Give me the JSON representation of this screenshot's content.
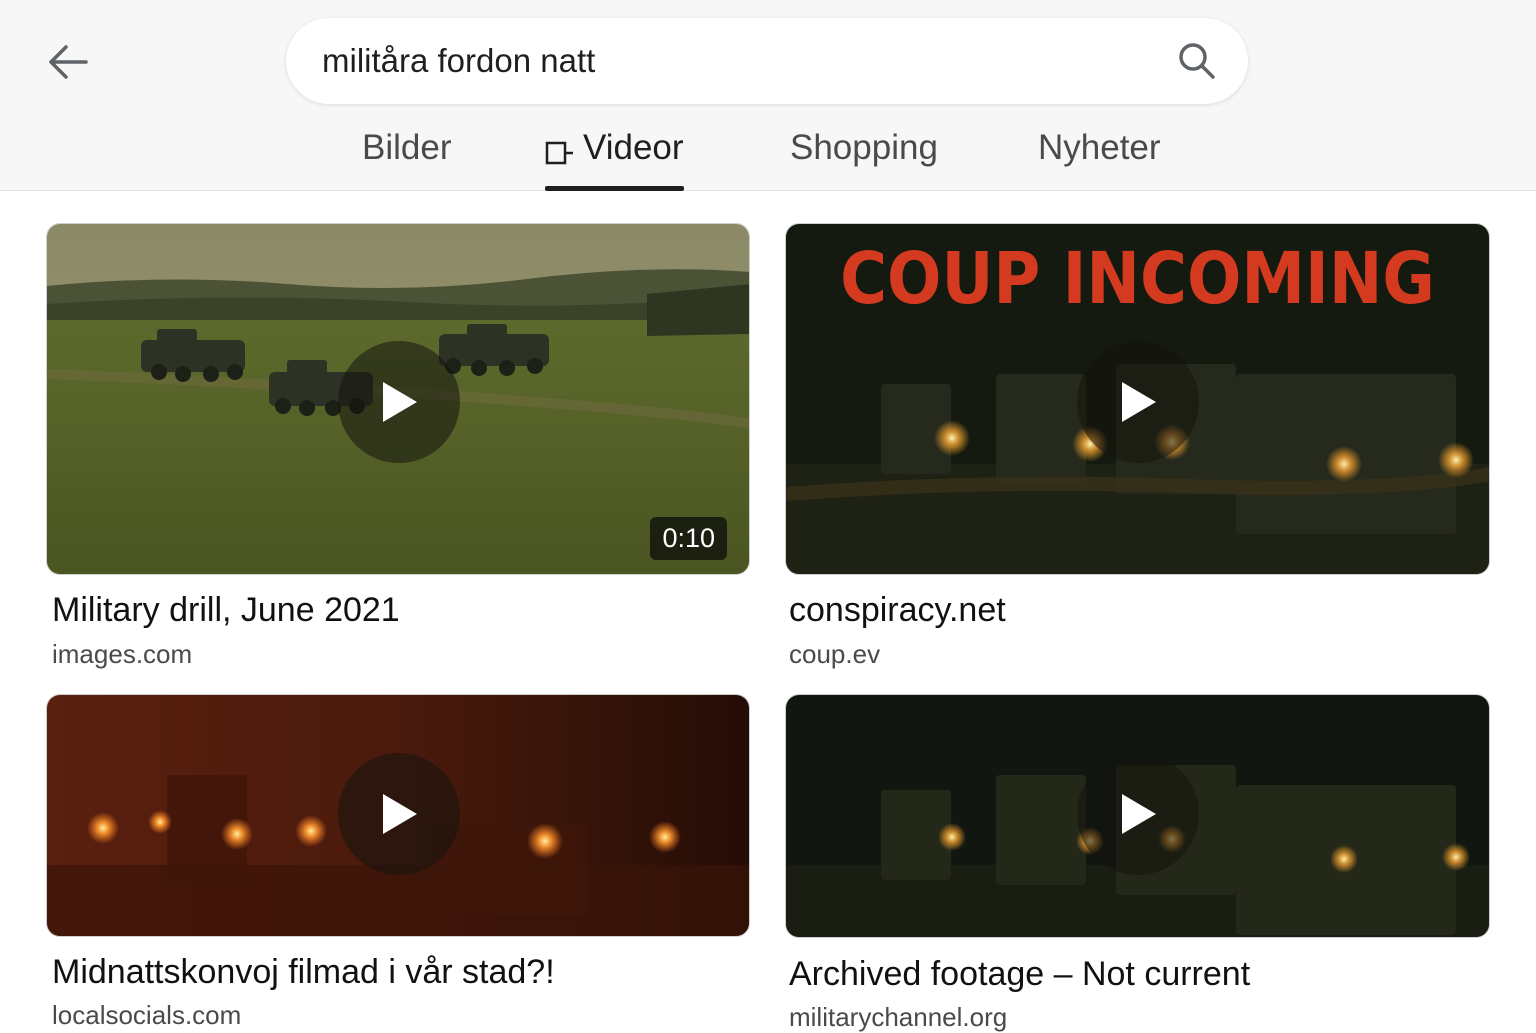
{
  "search": {
    "query": "militåra fordon natt"
  },
  "tabs": [
    {
      "label": "Bilder",
      "active": false
    },
    {
      "label": "Videor",
      "active": true
    },
    {
      "label": "Shopping",
      "active": false
    },
    {
      "label": "Nyheter",
      "active": false
    }
  ],
  "results": [
    {
      "title": "Military drill, June 2021",
      "source": "images.com",
      "duration": "0:10",
      "overlay_text": ""
    },
    {
      "title": "conspiracy.net",
      "source": "coup.ev",
      "duration": "",
      "overlay_text": "COUP INCOMING"
    },
    {
      "title": "Midnattskonvoj filmad i vår stad?!",
      "source": "localsocials.com",
      "duration": "",
      "overlay_text": ""
    },
    {
      "title": "Archived footage – Not current",
      "source": "militarychannel.org",
      "duration": "",
      "overlay_text": ""
    }
  ],
  "icons": {
    "back": "arrow-left-icon",
    "search": "search-icon",
    "video_tab": "video-icon",
    "play": "play-icon"
  },
  "colors": {
    "accent_text": "#d43a1f",
    "header_bg": "#f7f7f7"
  }
}
